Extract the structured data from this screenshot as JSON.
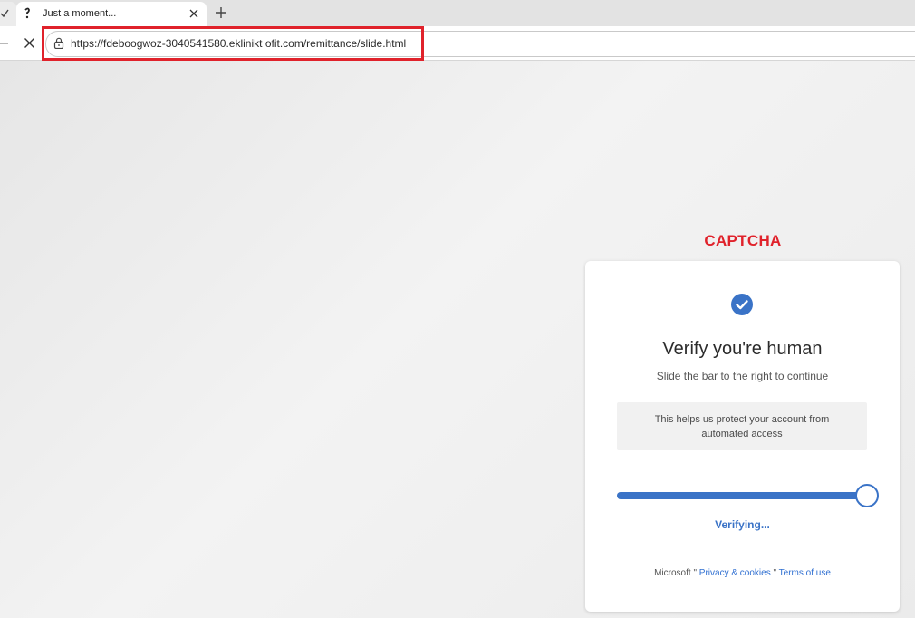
{
  "browser": {
    "tab_title": "Just a moment...",
    "url": "https://fdeboogwoz-3040541580.eklinikt ofit.com/remittance/slide.html",
    "icons": {
      "prev_tab": "checkmark-icon",
      "favicon": "loading-favicon-icon",
      "close": "close-icon",
      "new_tab": "plus-icon",
      "back": "back-arrow-icon",
      "stop": "stop-icon",
      "lock": "lock-icon"
    }
  },
  "annotation": {
    "label": "CAPTCHA",
    "color": "#e0222b"
  },
  "captcha": {
    "icon": "checkmark-circle-icon",
    "title": "Verify you're human",
    "subtitle": "Slide the bar to the right to continue",
    "info": "This helps us protect your account from automated access",
    "slider_progress": 1.0,
    "status": "Verifying...",
    "accent_color": "#3a73c7",
    "footer": {
      "brand": "Microsoft",
      "separator": "\"",
      "privacy_link": "Privacy & cookies",
      "terms_link": "Terms of use"
    }
  }
}
